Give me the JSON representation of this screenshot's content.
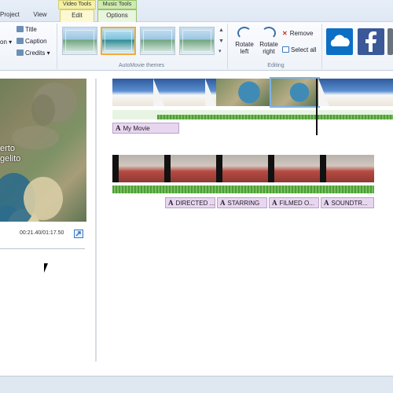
{
  "tabs": {
    "project": "Project",
    "view": "View",
    "edit": "Edit",
    "options": "Options",
    "video_tools": "Video Tools",
    "music_tools": "Music Tools"
  },
  "ribbon": {
    "title_label": "Title",
    "caption_label": "Caption",
    "credits_label": "Credits",
    "partial_label": "on",
    "themes_group": "AutoMovie themes",
    "editing_group": "Editing",
    "rotate_left": "Rotate\nleft",
    "rotate_right": "Rotate\nright",
    "remove_label": "Remove",
    "select_all_label": "Select all"
  },
  "preview": {
    "overlay_line1": "erto",
    "overlay_line2": "gelito",
    "timecode": "00:21.40/01:17.50"
  },
  "timeline": {
    "caption_my_movie": "My Movie",
    "credits": [
      "DIRECTED ...",
      "STARRING",
      "FILMED O...",
      "SOUNDTR..."
    ]
  },
  "colors": {
    "accent": "#3b77c2",
    "selected_theme": "#f2a93b",
    "caption_bg": "#e8d6f1",
    "audio_wave": "#4e9d3c",
    "video_tools_tab": "#f4f0a8",
    "music_tools_tab": "#cfe9b0"
  },
  "icons": [
    "title-icon",
    "caption-icon",
    "credits-icon",
    "rotate-left-icon",
    "rotate-right-icon",
    "remove-icon",
    "select-all-icon",
    "onedrive-icon",
    "facebook-icon",
    "expand-icon"
  ]
}
